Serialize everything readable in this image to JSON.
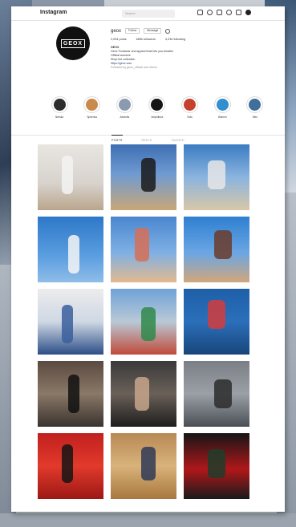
{
  "topbar": {
    "app_name": "Instagram",
    "search_placeholder": "Search"
  },
  "profile": {
    "username": "geox",
    "follow_label": "Follow",
    "message_label": "Message",
    "counts": {
      "posts": "2,094 posts",
      "followers": "689k followers",
      "following": "4,234 following"
    },
    "bio_name": "GEOX",
    "bio_lines": [
      "Geox Footwear and apparel that lets you breathe",
      "Official account",
      "Shop the collection"
    ],
    "bio_link": "https://geox.com",
    "bio_followed": "Followed by geox_official and others"
  },
  "highlights": [
    {
      "label": "Nebula",
      "color": "#2c2c2c"
    },
    {
      "label": "Spherica",
      "color": "#c98a4a"
    },
    {
      "label": "Aerantis",
      "color": "#8a9bb0"
    },
    {
      "label": "Amphibiox",
      "color": "#151515"
    },
    {
      "label": "Kids",
      "color": "#c6402e"
    },
    {
      "label": "Women",
      "color": "#2f8fcf"
    },
    {
      "label": "Men",
      "color": "#3f6f9a"
    }
  ],
  "tabs": [
    {
      "label": "POSTS",
      "active": true
    },
    {
      "label": "REELS",
      "active": false
    },
    {
      "label": "TAGGED",
      "active": false
    }
  ],
  "posts": [
    {
      "bg": "linear-gradient(180deg,#e9e6e2 0%,#d7d2cc 60%,#b9a58c 100%)",
      "accent": "#f3f3f3"
    },
    {
      "bg": "linear-gradient(180deg,#3e6fb3 0%,#6f9ad1 45%,#c8a778 100%)",
      "accent": "#1a1a1a"
    },
    {
      "bg": "linear-gradient(180deg,#3b7cc2 0%,#8ab4df 50%,#d9c7a7 100%)",
      "accent": "#e6e6e6"
    },
    {
      "bg": "linear-gradient(180deg,#2d78c8 0%,#5b9ee0 60%,#8fbde8 100%)",
      "accent": "#f4f4f4"
    },
    {
      "bg": "linear-gradient(180deg,#4a86d0 0%,#7fb0e3 55%,#e4b98f 100%)",
      "accent": "#d76f56"
    },
    {
      "bg": "linear-gradient(180deg,#2f7fd1 0%,#6aa6e3 55%,#d2a67a 100%)",
      "accent": "#6b3b2a"
    },
    {
      "bg": "linear-gradient(180deg,#ececec 0%,#cfd8e4 50%,#2d4e86 100%)",
      "accent": "#3a5f9e"
    },
    {
      "bg": "linear-gradient(180deg,#6fa2d8 0%,#b9c9d6 50%,#c04a3a 100%)",
      "accent": "#2f8a4a"
    },
    {
      "bg": "linear-gradient(180deg,#1e5fa8 0%,#2b6fba 50%,#18467a 100%)",
      "accent": "#d23c3c"
    },
    {
      "bg": "linear-gradient(180deg,#5b4a3f 0%,#8a7868 50%,#3a332e 100%)",
      "accent": "#111111"
    },
    {
      "bg": "linear-gradient(180deg,#3a3a3a 0%,#6a6058 50%,#1d1d1d 100%)",
      "accent": "#c8a48a"
    },
    {
      "bg": "linear-gradient(180deg,#7a7f86 0%,#9aa0a6 50%,#4b4f55 100%)",
      "accent": "#2b2b2b"
    },
    {
      "bg": "linear-gradient(180deg,#c0201e 0%,#e23a2c 50%,#9c1814 100%)",
      "accent": "#151515"
    },
    {
      "bg": "linear-gradient(180deg,#b88a55 0%,#d8b27a 50%,#a8783e 100%)",
      "accent": "#2e3a57"
    },
    {
      "bg": "linear-gradient(180deg,#161616 0%,#b0171a 55%,#1a1a1a 100%)",
      "accent": "#1e3d2c"
    }
  ]
}
